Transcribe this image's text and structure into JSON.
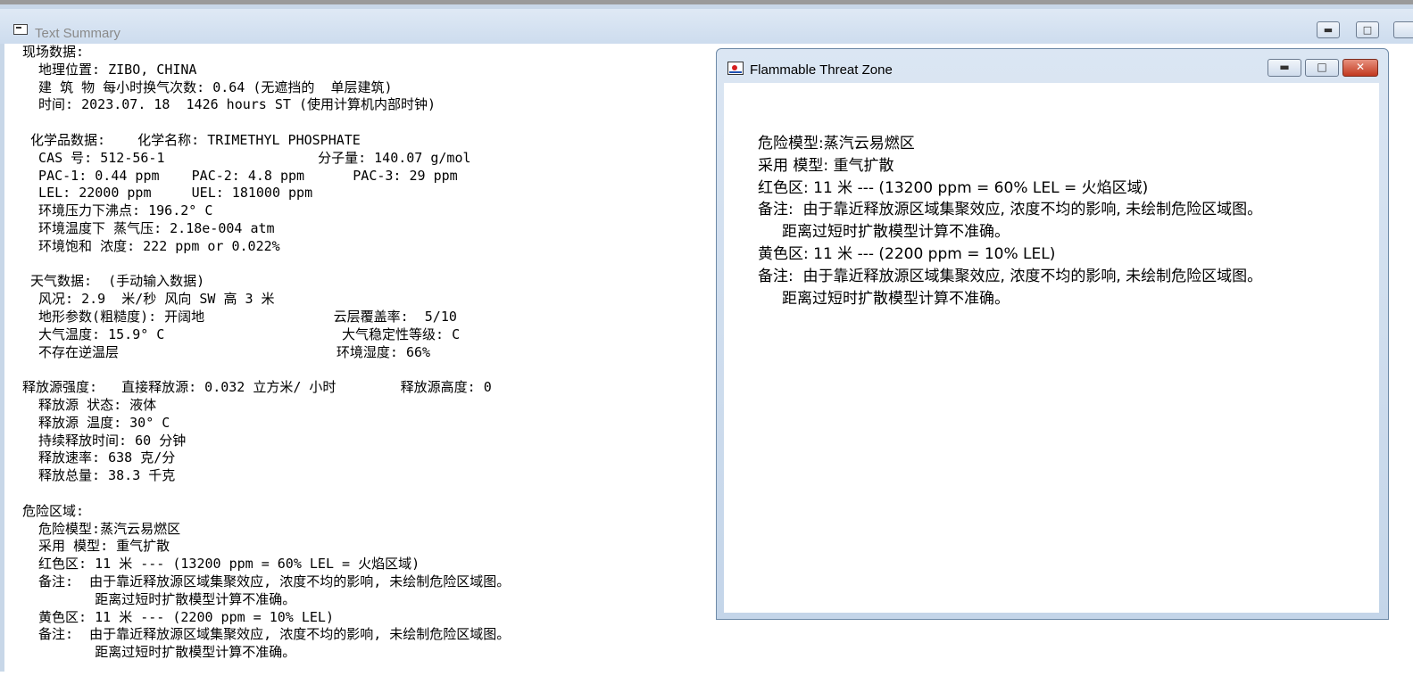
{
  "main_window": {
    "title": "Text Summary",
    "lines": [
      "现场数据:",
      "  地理位置: ZIBO, CHINA",
      "  建 筑 物 每小时换气次数: 0.64 (无遮挡的  单层建筑)",
      "  时间: 2023.07. 18  1426 hours ST (使用计算机内部时钟)",
      "",
      " 化学品数据:    化学名称: TRIMETHYL PHOSPHATE",
      "  CAS 号: 512-56-1                   分子量: 140.07 g/mol",
      "  PAC-1: 0.44 ppm    PAC-2: 4.8 ppm      PAC-3: 29 ppm",
      "  LEL: 22000 ppm     UEL: 181000 ppm",
      "  环境压力下沸点: 196.2° C",
      "  环境温度下 蒸气压: 2.18e-004 atm",
      "  环境饱和 浓度: 222 ppm or 0.022%",
      "",
      " 天气数据:  (手动输入数据)",
      "  风况: 2.9  米/秒 风向 SW 高 3 米",
      "  地形参数(粗糙度): 开阔地                云层覆盖率:  5/10",
      "  大气温度: 15.9° C                      大气稳定性等级: C",
      "  不存在逆温层                           环境湿度: 66%",
      "",
      "释放源强度:   直接释放源: 0.032 立方米/ 小时        释放源高度: 0",
      "  释放源 状态: 液体",
      "  释放源 温度: 30° C",
      "  持续释放时间: 60 分钟",
      "  释放速率: 638 克/分",
      "  释放总量: 38.3 千克",
      "",
      "危险区域:",
      "  危险模型:蒸汽云易燃区",
      "  采用 模型: 重气扩散",
      "  红色区: 11 米 --- (13200 ppm = 60% LEL = 火焰区域)",
      "  备注:  由于靠近释放源区域集聚效应, 浓度不均的影响, 未绘制危险区域图。",
      "         距离过短时扩散模型计算不准确。",
      "  黄色区: 11 米 --- (2200 ppm = 10% LEL)",
      "  备注:  由于靠近释放源区域集聚效应, 浓度不均的影响, 未绘制危险区域图。",
      "         距离过短时扩散模型计算不准确。"
    ]
  },
  "zone_window": {
    "title": "Flammable Threat Zone",
    "lines": [
      "危险模型:蒸汽云易燃区",
      "采用 模型: 重气扩散",
      "红色区: 11 米 --- (13200 ppm = 60% LEL = 火焰区域)",
      "备注:  由于靠近释放源区域集聚效应, 浓度不均的影响, 未绘制危险区域图。",
      "     距离过短时扩散模型计算不准确。",
      "黄色区: 11 米 --- (2200 ppm = 10% LEL)",
      "备注:  由于靠近释放源区域集聚效应, 浓度不均的影响, 未绘制危险区域图。",
      "     距离过短时扩散模型计算不准确。"
    ]
  },
  "colors": {
    "titlebar": "#cddcee",
    "close_button": "#c2391f",
    "client_bg": "#ffffff"
  }
}
